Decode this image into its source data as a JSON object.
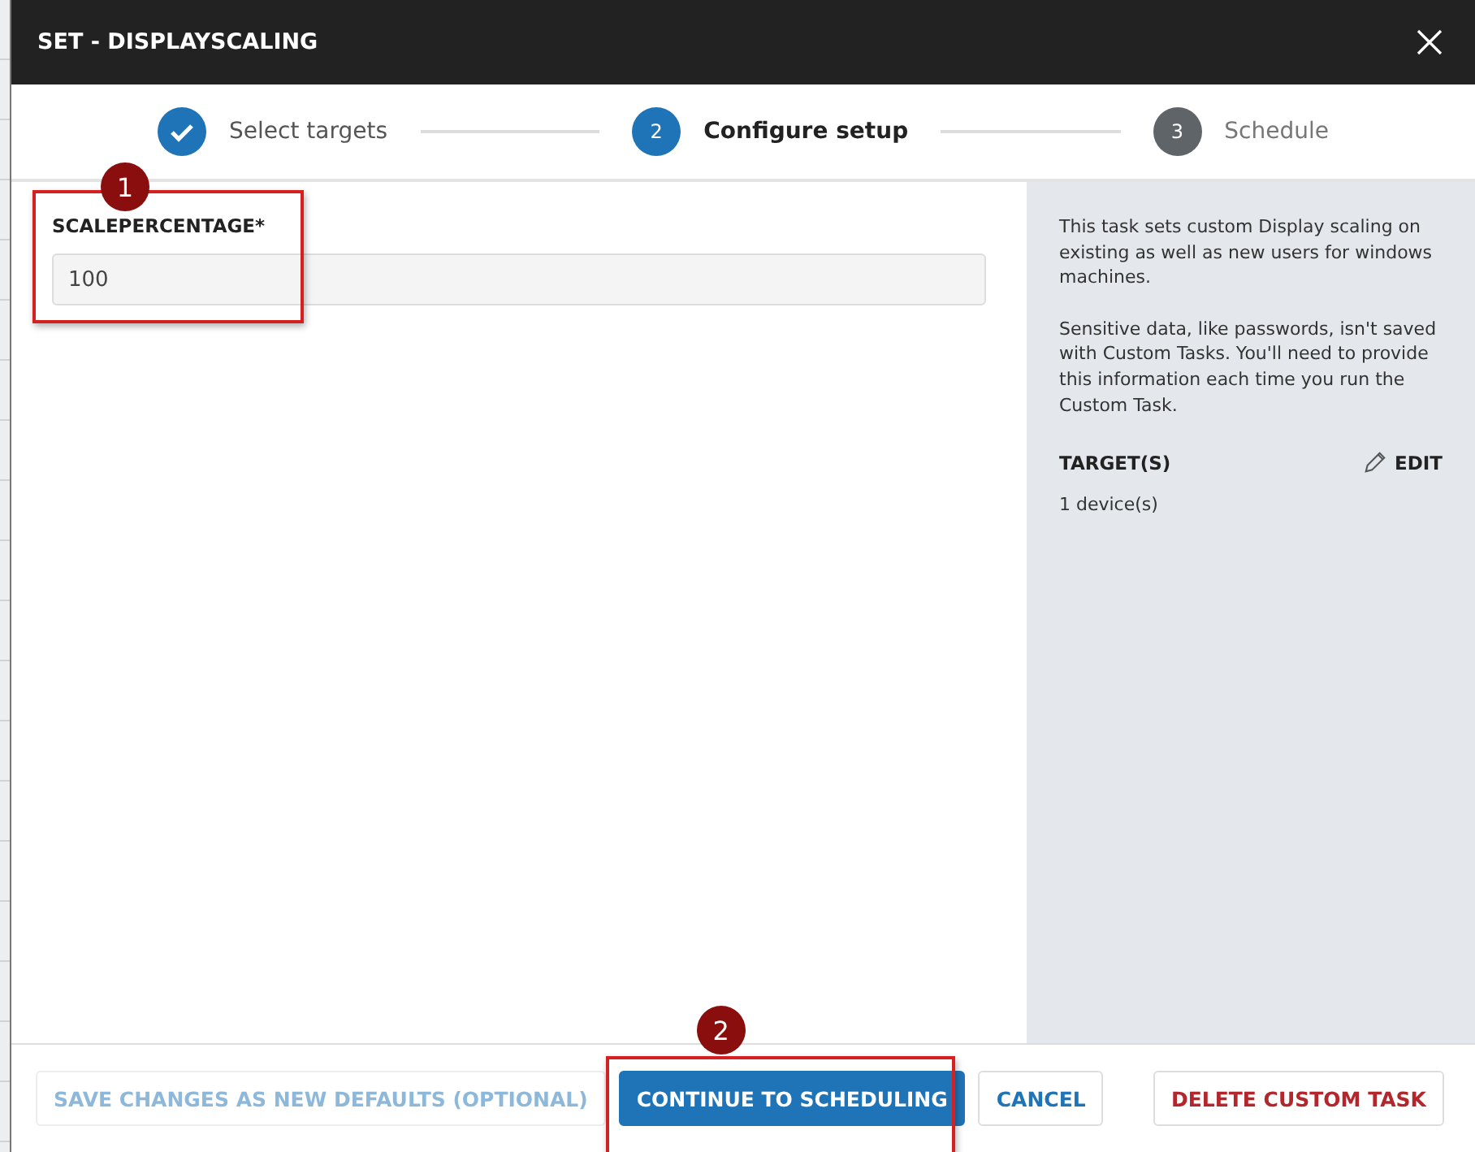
{
  "window": {
    "title": "SET - DISPLAYSCALING"
  },
  "steps": [
    {
      "label": "Select targets",
      "done": true,
      "selected": false
    },
    {
      "number": "2",
      "label": "Configure setup",
      "done": false,
      "selected": true
    },
    {
      "number": "3",
      "label": "Schedule",
      "done": false,
      "selected": false
    }
  ],
  "field": {
    "label": "SCALEPERCENTAGE*",
    "value": "100",
    "annotation": "1"
  },
  "info": {
    "paragraphs": [
      "This task sets custom Display scaling on existing as well as new users for windows machines.",
      "Sensitive data, like passwords, isn't saved with Custom Tasks. You'll need to provide this information each time you run the Custom Task."
    ],
    "targets_label": "TARGET(S)",
    "edit": "EDIT",
    "targets_value": "1 device(s)"
  },
  "footer": [
    {
      "label": "SAVE CHANGES AS NEW DEFAULTS (OPTIONAL)",
      "kind": "secondary",
      "disabled": true
    },
    {
      "label": "CONTINUE TO SCHEDULING",
      "kind": "primary",
      "disabled": false,
      "annotation": "2"
    },
    {
      "label": "CANCEL",
      "kind": "secondary",
      "disabled": false
    },
    {
      "label": "DELETE CUSTOM TASK",
      "kind": "danger",
      "disabled": false
    }
  ]
}
